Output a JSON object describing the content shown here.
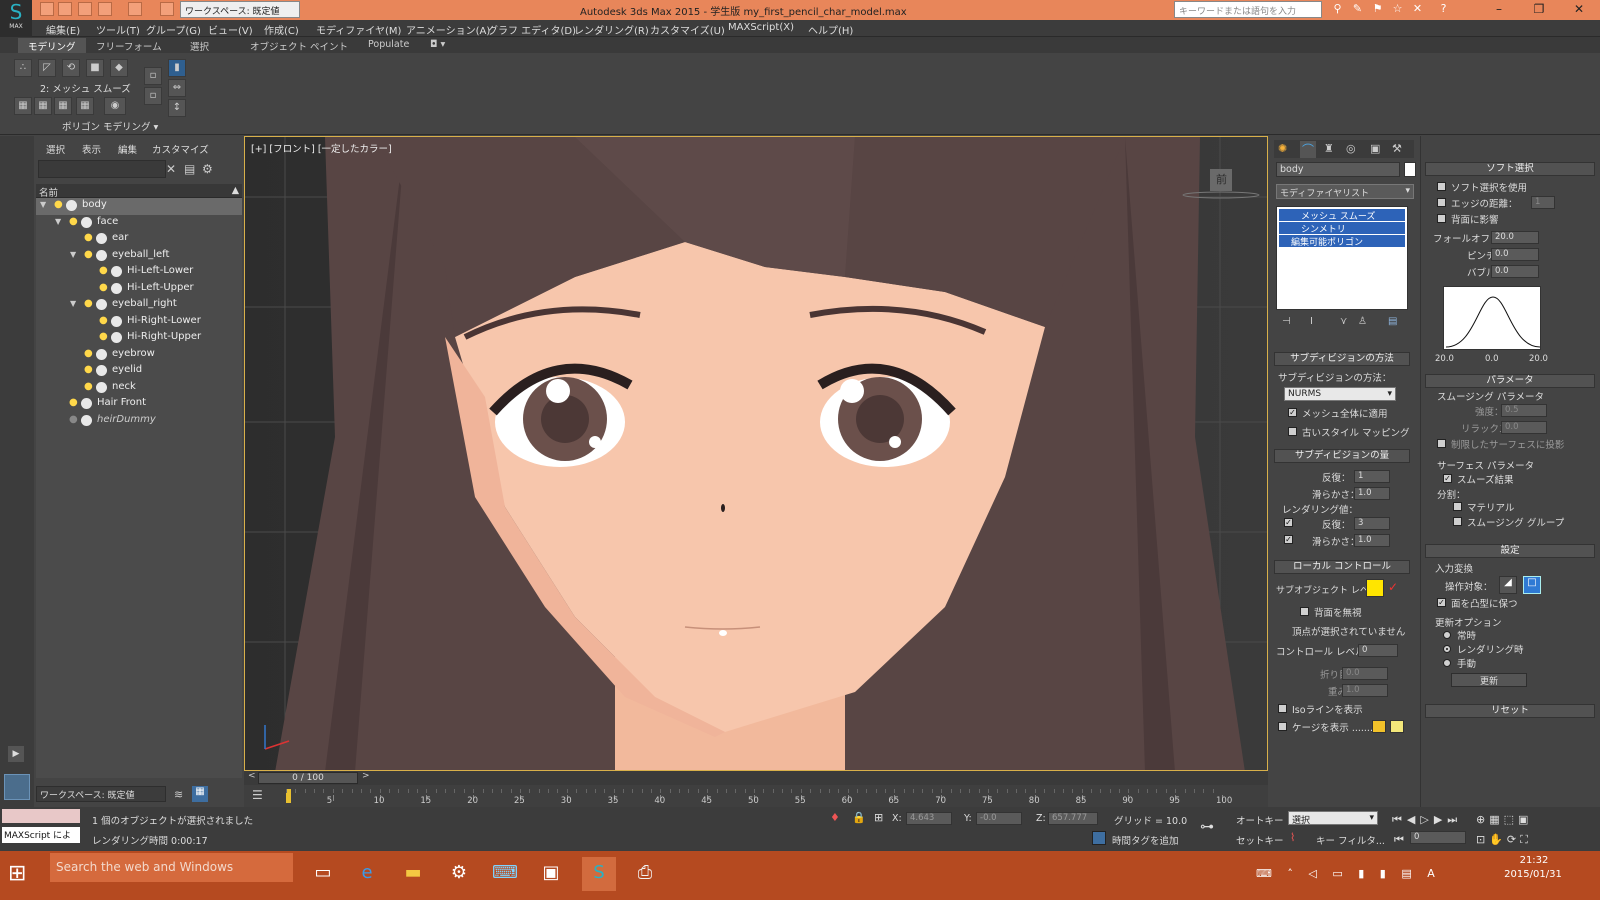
{
  "app": {
    "title": "Autodesk 3ds Max  2015   -  学生版    my_first_pencil_char_model.max",
    "workspace_select": "ワークスペース: 既定値",
    "search_placeholder": "キーワードまたは語句を入力",
    "logo": "MAX"
  },
  "menu": [
    "編集(E)",
    "ツール(T)",
    "グループ(G)",
    "ビュー(V)",
    "作成(C)",
    "モディファイヤ(M)",
    "アニメーション(A)",
    "グラフ エディタ(D)",
    "レンダリング(R)",
    "カスタマイズ(U)",
    "MAXScript(X)",
    "ヘルプ(H)"
  ],
  "ribbon": {
    "tabs": [
      "モデリング",
      "フリーフォーム",
      "選択",
      "オブジェクト ペイント",
      "Populate"
    ],
    "active_tab": 0,
    "level_label": "2: メッシュ スムーズ",
    "panel_title": "ポリゴン モデリング ▾"
  },
  "scene_explorer": {
    "menus": [
      "選択",
      "表示",
      "編集",
      "カスタマイズ"
    ],
    "column": "名前",
    "items": [
      {
        "name": "body",
        "depth": 0,
        "expand": true,
        "selected": true
      },
      {
        "name": "face",
        "depth": 1,
        "expand": true
      },
      {
        "name": "ear",
        "depth": 2
      },
      {
        "name": "eyeball_left",
        "depth": 2,
        "expand": true
      },
      {
        "name": "Hi-Left-Lower",
        "depth": 3
      },
      {
        "name": "Hi-Left-Upper",
        "depth": 3
      },
      {
        "name": "eyeball_right",
        "depth": 2,
        "expand": true
      },
      {
        "name": "Hi-Right-Lower",
        "depth": 3
      },
      {
        "name": "Hi-Right-Upper",
        "depth": 3
      },
      {
        "name": "eyebrow",
        "depth": 2
      },
      {
        "name": "eyelid",
        "depth": 2
      },
      {
        "name": "neck",
        "depth": 2
      },
      {
        "name": "Hair Front",
        "depth": 1
      },
      {
        "name": "heirDummy",
        "depth": 1,
        "italic": true
      }
    ],
    "workspace": "ワークスペース: 既定値"
  },
  "viewport": {
    "label": "[+] [フロント] [一定したカラー]",
    "gizmo_label": "前"
  },
  "command_panel": {
    "object_name": "body",
    "modifier_list": "モディファイヤリスト",
    "stack": [
      "メッシュ スムーズ",
      "シンメトリ",
      "編集可能ポリゴン"
    ],
    "subdiv_method": {
      "title": "サブディビジョンの方法",
      "label": "サブディビジョンの方法：",
      "value": "NURMS",
      "apply_all": "メッシュ全体に適用",
      "old_style": "古いスタイル マッピング"
    },
    "subdiv_amount": {
      "title": "サブディビジョンの量",
      "iterations_label": "反復：",
      "iterations": "1",
      "smoothness_label": "滑らかさ：",
      "smoothness": "1.0",
      "render_label": "レンダリング値：",
      "r_iterations": "3",
      "r_smoothness": "1.0"
    },
    "local_control": {
      "title": "ローカル コントロール",
      "sublevel": "サブオブジェクト レベル：",
      "ignore_back": "背面を無視",
      "no_vertex": "頂点が選択されていません",
      "control_level": "コントロール レベル：",
      "control_level_val": "0",
      "crease": "折り目：",
      "crease_val": "0.0",
      "weight": "重み：",
      "weight_val": "1.0",
      "iso": "Isoラインを表示",
      "cage": "ケージを表示 ........"
    }
  },
  "right_panel": {
    "soft_select": {
      "title": "ソフト選択",
      "use": "ソフト選択を使用",
      "edge_dist": "エッジの距離：",
      "edge_dist_val": "1",
      "affect_back": "背面に影響",
      "falloff": "フォールオフ：",
      "falloff_val": "20.0",
      "pinch": "ピンチ：",
      "pinch_val": "0.0",
      "bubble": "バブル：",
      "bubble_val": "0.0",
      "curve_labels": [
        "20.0",
        "0.0",
        "20.0"
      ]
    },
    "params": {
      "title": "パラメータ",
      "smoothing": "スムージング パラメータ",
      "strength": "強度：",
      "strength_val": "0.5",
      "relax": "リラックス：",
      "relax_val": "0.0",
      "project": "制限したサーフェスに投影",
      "surface": "サーフェス パラメータ",
      "smooth_result": "スムーズ結果",
      "separate": "分割：",
      "material": "マテリアル",
      "smoothing_group": "スムージング グループ"
    },
    "settings": {
      "title": "設定",
      "input": "入力変換",
      "operate": "操作対象：",
      "keep_convex": "面を凸型に保つ",
      "update_opts": "更新オプション",
      "always": "常時",
      "when_render": "レンダリング時",
      "manual": "手動",
      "update_btn": "更新"
    },
    "reset": "リセット"
  },
  "timeline": {
    "frame": "0 / 100",
    "ticks": [
      "5",
      "10",
      "15",
      "20",
      "25",
      "30",
      "35",
      "40",
      "45",
      "50",
      "55",
      "60",
      "65",
      "70",
      "75",
      "80",
      "85",
      "90",
      "95",
      "100"
    ]
  },
  "status": {
    "maxscript": "MAXScript によ",
    "message": "1 個のオブジェクトが選択されました",
    "render_time": "レンダリング時間  0:00:17",
    "x_label": "X:",
    "x": "4.643",
    "y_label": "Y:",
    "y": "-0.0",
    "z_label": "Z:",
    "z": "657.777",
    "grid": "グリッド = 10.0",
    "add_time_tag": "時間タグを追加",
    "autokey": "オートキー",
    "setkey": "セットキー",
    "select_mode": "選択",
    "key_filters": "キー フィルタ...",
    "frame_field": "0"
  },
  "taskbar": {
    "search": "Search the web and Windows",
    "time": "21:32",
    "date": "2015/01/31"
  },
  "colors": {
    "title_bg": "#e8865a",
    "taskbar_bg": "#b54a20",
    "skin": "#f7c6ac",
    "hair": "#584544"
  }
}
